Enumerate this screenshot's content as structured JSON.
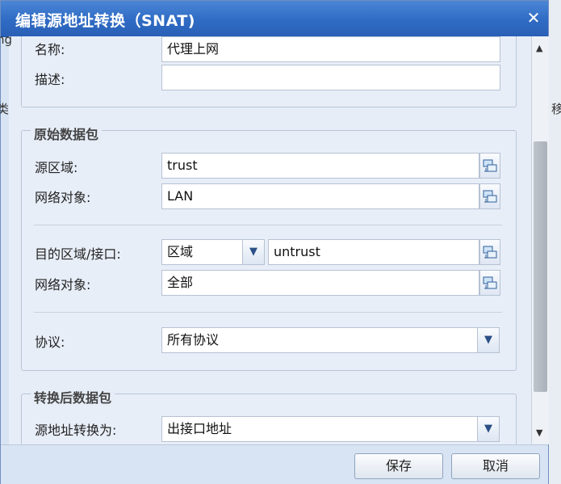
{
  "dialog": {
    "title": "编辑源地址转换（SNAT)",
    "close_glyph": "✕"
  },
  "background": {
    "left_fragments": [
      "ng",
      "类"
    ],
    "right_fragment": "移"
  },
  "basic": {
    "name_label": "名称:",
    "name_value": "代理上网",
    "desc_label": "描述:",
    "desc_value": ""
  },
  "original_packet": {
    "legend": "原始数据包",
    "src_zone_label": "源区域:",
    "src_zone_value": "trust",
    "src_obj_label": "网络对象:",
    "src_obj_value": "LAN",
    "dst_label": "目的区域/接口:",
    "dst_type_value": "区域",
    "dst_value": "untrust",
    "dst_obj_label": "网络对象:",
    "dst_obj_value": "全部",
    "protocol_label": "协议:",
    "protocol_value": "所有协议"
  },
  "translated_packet": {
    "legend": "转换后数据包",
    "src_translate_label": "源地址转换为:",
    "src_translate_value": "出接口地址"
  },
  "footer": {
    "save_label": "保存",
    "cancel_label": "取消"
  },
  "icons": {
    "picker": "network-picker-icon",
    "dropdown": "chevron-down-icon"
  }
}
